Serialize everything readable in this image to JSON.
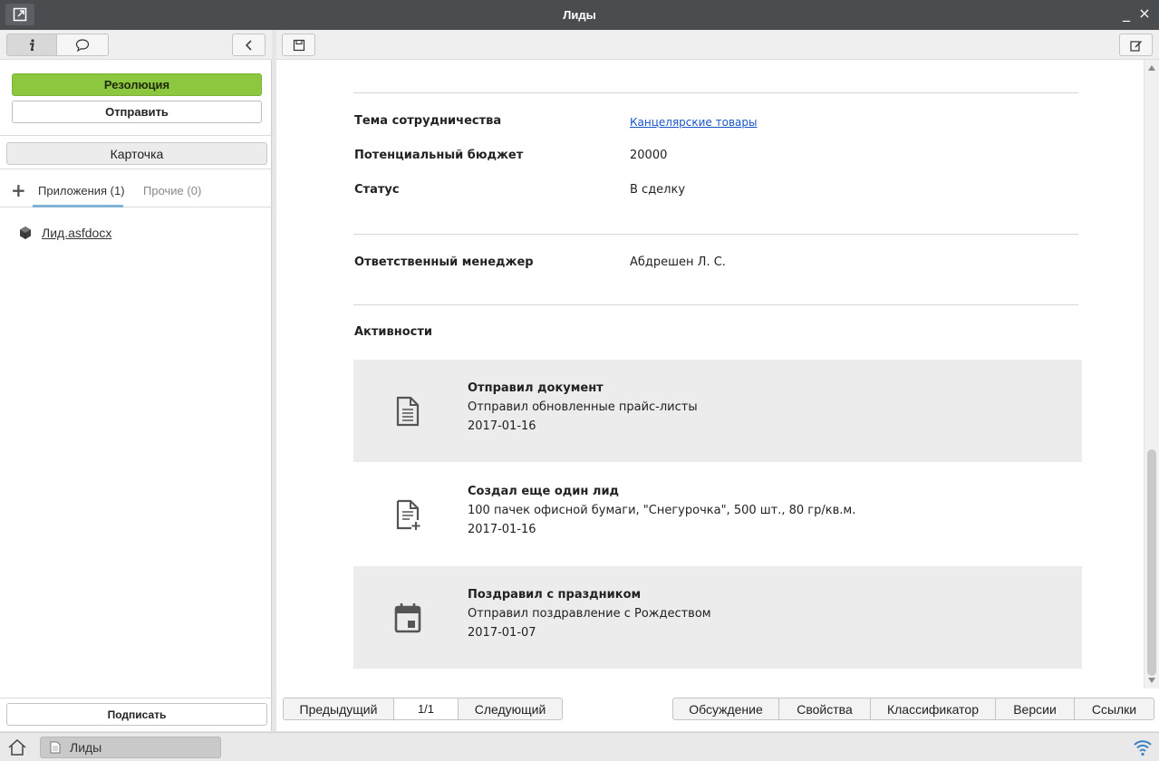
{
  "window": {
    "title": "Лиды",
    "minimize": "_",
    "close": "×"
  },
  "left": {
    "tabs": {
      "info_icon": "info-icon",
      "chat_icon": "speech-bubble-icon"
    },
    "resolution_label": "Резолюция",
    "send_label": "Отправить",
    "card_label": "Карточка",
    "attach_tabs": [
      {
        "label": "Приложения (1)",
        "active": true
      },
      {
        "label": "Прочие (0)",
        "active": false
      }
    ],
    "files": [
      {
        "name": "Лид.asfdocx",
        "icon": "document-cube-icon"
      }
    ],
    "sign_label": "Подписать"
  },
  "doc": {
    "fields": [
      {
        "label": "Тема сотрудничества",
        "value": "Канцелярские товары",
        "link": true
      },
      {
        "label": "Потенциальный бюджет",
        "value": "20000"
      },
      {
        "label": "Статус",
        "value": "В сделку"
      }
    ],
    "manager": {
      "label": "Ответственный менеджер",
      "value": "Абдрешен Л. С."
    },
    "activities_title": "Активности",
    "activities": [
      {
        "title": "Отправил документ",
        "desc": "Отправил обновленные прайс-листы",
        "date": "2017-01-16",
        "icon": "document-icon"
      },
      {
        "title": "Создал еще один лид",
        "desc": "100 пачек офисной бумаги, \"Снегурочка\", 500 шт., 80 гр/кв.м.",
        "date": "2017-01-16",
        "icon": "document-add-icon"
      },
      {
        "title": "Поздравил с праздником",
        "desc": "Отправил поздравление с Рождеством",
        "date": "2017-01-07",
        "icon": "calendar-icon"
      }
    ]
  },
  "nav": {
    "prev": "Предыдущий",
    "page": "1/1",
    "next": "Следующий",
    "tabs": [
      "Обсуждение",
      "Свойства",
      "Классификатор",
      "Версии",
      "Ссылки"
    ]
  },
  "taskbar": {
    "item_label": "Лиды"
  },
  "colors": {
    "resolution_bg": "#8dc63f",
    "titlebar_bg": "#4a4d50",
    "link": "#1a55c8",
    "tab_underline": "#7fb4d8"
  }
}
